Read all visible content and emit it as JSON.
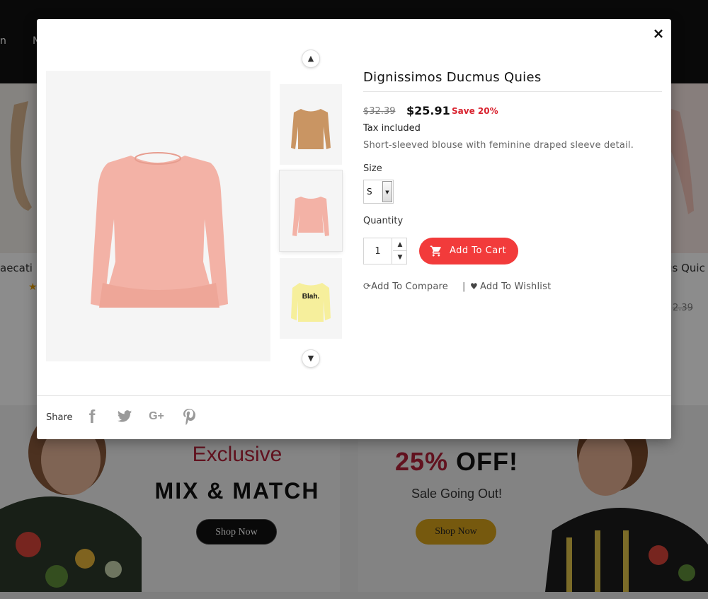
{
  "background": {
    "nav_left": "n",
    "nav_second": "N",
    "product_left_name": "aecati",
    "product_right_name": "us Quic",
    "product_right_old_price": "2.39",
    "star": "★",
    "banner_left": {
      "heading": "Exclusive",
      "title": "MIX & MATCH",
      "button": "Shop Now"
    },
    "banner_right": {
      "discount_pct": "25%",
      "discount_word": "OFF!",
      "subtitle": "Sale Going Out!",
      "button": "Shop Now"
    }
  },
  "modal": {
    "close_label": "×",
    "product": {
      "title": "Dignissimos Ducmus Quies",
      "price_old": "$32.39",
      "price_new": "$25.91",
      "save": "Save 20%",
      "tax": "Tax included",
      "description": "Short-sleeved blouse with feminine draped sleeve detail."
    },
    "size": {
      "label": "Size",
      "selected": "S"
    },
    "quantity": {
      "label": "Quantity",
      "value": "1"
    },
    "add_to_cart": "Add To Cart",
    "compare": "Add To Compare",
    "separator": "|",
    "wishlist": "Add To Wishlist",
    "thumbnails": [
      "sweater-tan",
      "blouse-pink",
      "sweatshirt-yellow"
    ],
    "thumb_text": "Blah.",
    "share": {
      "label": "Share",
      "facebook": "f",
      "google": "G+"
    }
  },
  "colors": {
    "accent": "#f23b3b",
    "save": "#d9232f",
    "banner_red": "#b2223a",
    "banner_gold": "#d7a21a"
  }
}
